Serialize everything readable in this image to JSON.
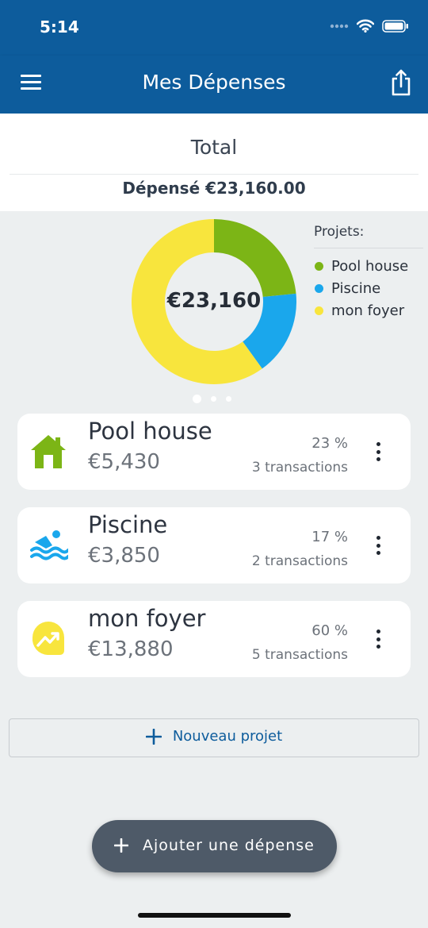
{
  "status": {
    "time": "5:14"
  },
  "nav": {
    "title": "Mes Dépenses"
  },
  "summary": {
    "total_label": "Total",
    "spent_text": "Dépensé €23,160.00",
    "center_amount": "€23,160"
  },
  "legend": {
    "title": "Projets:",
    "items": [
      {
        "label": "Pool house",
        "color": "#7cb516"
      },
      {
        "label": "Piscine",
        "color": "#1aa7ec"
      },
      {
        "label": "mon foyer",
        "color": "#f8e53d"
      }
    ]
  },
  "chart_data": {
    "type": "pie",
    "total": 23160,
    "slices": [
      {
        "label": "Pool house",
        "value": 5430,
        "color": "#7cb516"
      },
      {
        "label": "Piscine",
        "value": 3850,
        "color": "#1aa7ec"
      },
      {
        "label": "mon foyer",
        "value": 13880,
        "color": "#f8e53d"
      }
    ]
  },
  "pager": {
    "pages": 3,
    "active": 0
  },
  "projects": [
    {
      "name": "Pool house",
      "amount": "€5,430",
      "percent": "23 %",
      "transactions": "3 transactions",
      "icon": "house-icon",
      "color": "#7cb516"
    },
    {
      "name": "Piscine",
      "amount": "€3,850",
      "percent": "17 %",
      "transactions": "2 transactions",
      "icon": "swimmer-icon",
      "color": "#1aa7ec"
    },
    {
      "name": "mon foyer",
      "amount": "€13,880",
      "percent": "60 %",
      "transactions": "5 transactions",
      "icon": "trend-up-icon",
      "color": "#f8e53d"
    }
  ],
  "new_project": {
    "label": "Nouveau projet"
  },
  "fab": {
    "label": "Ajouter une dépense"
  }
}
